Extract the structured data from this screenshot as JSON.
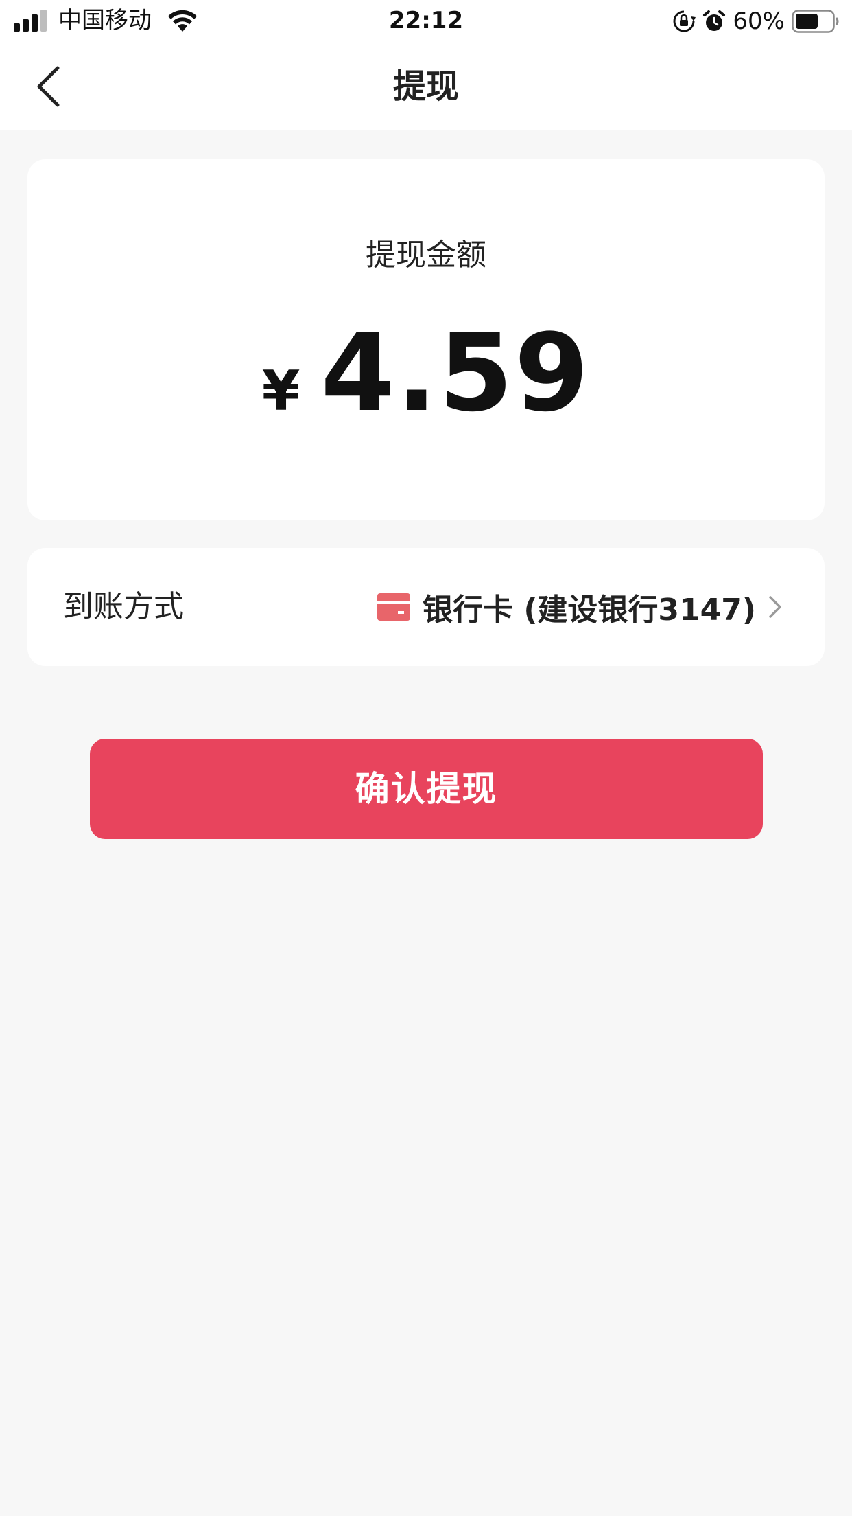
{
  "status_bar": {
    "carrier": "中国移动",
    "time": "22:12",
    "battery_percent": "60%",
    "icons": [
      "signal-icon",
      "wifi-icon",
      "rotation-lock-icon",
      "alarm-icon",
      "battery-icon"
    ]
  },
  "nav": {
    "title": "提现",
    "back_icon": "chevron-left-icon"
  },
  "amount_card": {
    "label": "提现金额",
    "currency_symbol": "¥",
    "amount": "4.59"
  },
  "method_card": {
    "label": "到账方式",
    "value": "银行卡 (建设银行3147)",
    "icon": "bank-card-icon",
    "chevron_icon": "chevron-right-icon"
  },
  "confirm_button": {
    "label": "确认提现"
  },
  "colors": {
    "accent": "#e8445d",
    "card_icon": "#e8656a",
    "background": "#f7f7f7",
    "surface": "#ffffff",
    "text": "#111111"
  }
}
